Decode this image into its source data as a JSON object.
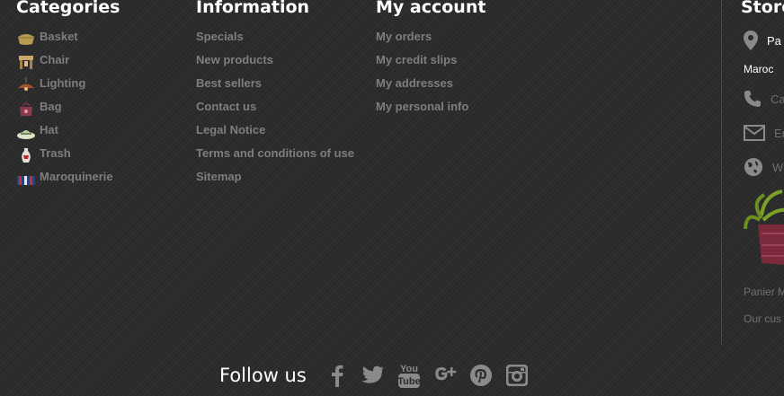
{
  "categories": {
    "title": "Categories",
    "items": [
      {
        "label": "Basket",
        "icon": "basket-icon"
      },
      {
        "label": "Chair",
        "icon": "chair-icon"
      },
      {
        "label": "Lighting",
        "icon": "lamp-icon"
      },
      {
        "label": "Bag",
        "icon": "bag-icon"
      },
      {
        "label": "Hat",
        "icon": "hat-icon"
      },
      {
        "label": "Trash",
        "icon": "vase-icon"
      },
      {
        "label": "Maroquinerie",
        "icon": "pouf-icon"
      }
    ]
  },
  "information": {
    "title": "Information",
    "items": [
      "Specials",
      "New products",
      "Best sellers",
      "Contact us",
      "Legal Notice",
      "Terms and conditions of use",
      "Sitemap"
    ]
  },
  "account": {
    "title": "My account",
    "items": [
      "My orders",
      "My credit slips",
      "My addresses",
      "My personal info"
    ]
  },
  "store": {
    "title": "Store",
    "address_line1": "Pa",
    "address_line2": "Maroc",
    "phone": "Ca",
    "email": "Er",
    "website": "W",
    "text1": "Panier M",
    "text2": "Our cus"
  },
  "follow": {
    "label": "Follow us",
    "networks": [
      "facebook",
      "twitter",
      "youtube",
      "google-plus",
      "pinterest",
      "instagram"
    ],
    "youtube_text": [
      "You",
      "Tube"
    ]
  },
  "colors": {
    "background": "#2a2a2a",
    "heading": "#ffffff",
    "link": "#7e7e7e",
    "icon": "#888888"
  }
}
